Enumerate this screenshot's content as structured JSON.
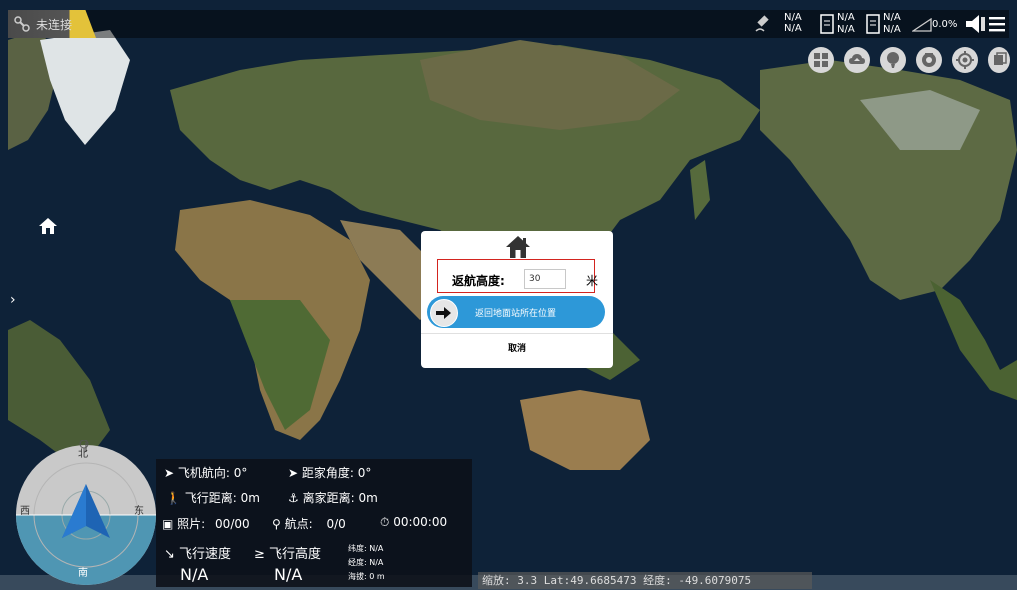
{
  "connection": {
    "status_text": "未连接"
  },
  "status_bar": {
    "gps": [
      "N/A",
      "N/A"
    ],
    "battery1": [
      "N/A",
      "N/A"
    ],
    "battery2": [
      "N/A",
      "N/A"
    ],
    "signal_percent": "0.0%"
  },
  "toolbar": {
    "icons": [
      "grid-icon",
      "cloud-icon",
      "balloon-icon",
      "camera-icon",
      "target-icon",
      "layers-icon"
    ]
  },
  "dialog": {
    "rth_label": "返航高度:",
    "rth_value": "30",
    "rth_unit": "米",
    "return_button_label": "返回地面站所在位置",
    "cancel_label": "取消"
  },
  "compass": {
    "north": "北",
    "south": "南",
    "east": "东",
    "west": "西"
  },
  "info_panel": {
    "heading_label": "飞机航向: 0°",
    "home_angle_label": "距家角度: 0°",
    "distance_label": "飞行距离: 0m",
    "home_distance_label": "离家距离: 0m",
    "photo_label": "照片:",
    "photo_value": "00/00",
    "waypoint_label": "航点:",
    "waypoint_value": "0/0",
    "timer_value": "00:00:00",
    "speed_label": "飞行速度",
    "speed_value": "N/A",
    "altitude_label": "飞行高度",
    "altitude_value": "N/A",
    "lat_label": "纬度: N/A",
    "lon_label": "经度: N/A",
    "alt_sea_label": "海拔: 0 m"
  },
  "coords": {
    "text": "缩放: 3.3  Lat:49.6685473   经度: -49.6079075"
  },
  "colors": {
    "accent": "#2d98d8",
    "highlight": "#d3241f",
    "connection_warning": "#e3c23a"
  }
}
